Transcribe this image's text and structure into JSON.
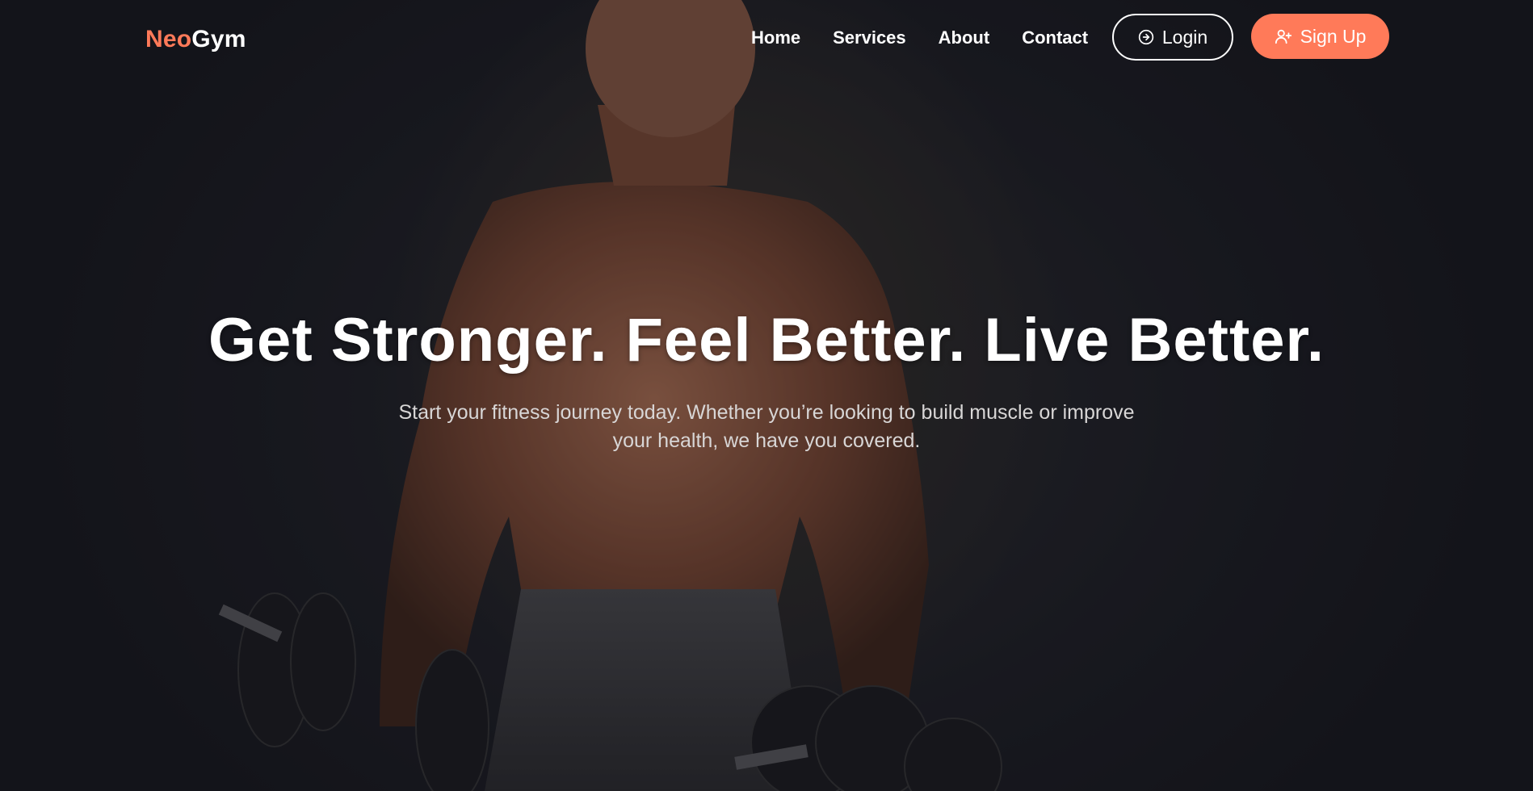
{
  "brand": {
    "name_accent": "Neo",
    "name_rest": "Gym",
    "accent_color": "#ff7a59"
  },
  "nav": {
    "items": [
      "Home",
      "Services",
      "About",
      "Contact"
    ]
  },
  "auth": {
    "login_label": "Login",
    "login_icon": "login-icon",
    "signup_label": "Sign Up",
    "signup_icon": "user-plus-icon"
  },
  "hero": {
    "headline": "Get Stronger. Feel Better. Live Better.",
    "subtext": "Start your fitness journey today. Whether you’re looking to build muscle or improve your health, we have you covered.",
    "background_image": "muscular man holding dumbbells"
  }
}
